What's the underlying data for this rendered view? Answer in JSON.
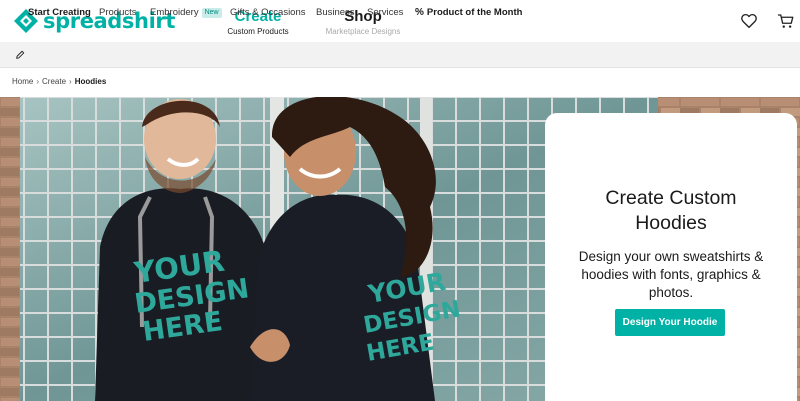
{
  "brand": {
    "name": "spreadshirt",
    "accent": "#00b2a5"
  },
  "header": {
    "create": {
      "title": "Create",
      "subtitle": "Custom Products"
    },
    "shop": {
      "title": "Shop",
      "subtitle": "Marketplace Designs"
    },
    "icons": [
      "heart-icon",
      "cart-icon"
    ]
  },
  "nav": {
    "items": [
      {
        "label": "Start Creating",
        "icon": "pencil-icon"
      },
      {
        "label": "Products"
      },
      {
        "label": "Embroidery",
        "badge": "New"
      },
      {
        "label": "Gifts & Occasions"
      },
      {
        "label": "Business"
      },
      {
        "label": "Services"
      },
      {
        "label": "Product of the Month",
        "icon": "percent-icon"
      }
    ]
  },
  "breadcrumb": {
    "items": [
      "Home",
      "Create",
      "Hoodies"
    ]
  },
  "hero": {
    "title_line1": "Create Custom",
    "title_line2": "Hoodies",
    "sub_line1": "Design your own sweatshirts &",
    "sub_line2": "hoodies with fonts, graphics &",
    "sub_line3": "photos.",
    "cta": "Design Your Hoodie",
    "print_text": [
      "YOUR",
      "DESIGN",
      "HERE"
    ]
  }
}
